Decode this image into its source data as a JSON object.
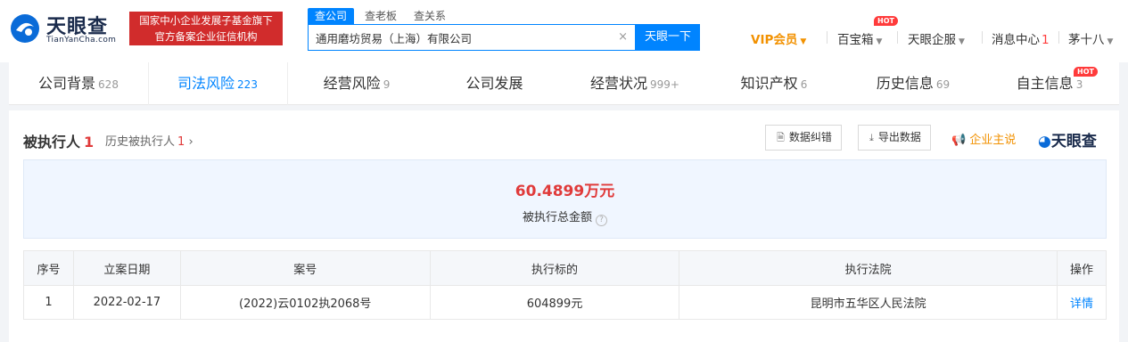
{
  "header": {
    "logo_name": "天眼查",
    "logo_domain": "TianYanCha.com",
    "banner_line1": "国家中小企业发展子基金旗下",
    "banner_line2": "官方备案企业征信机构",
    "search_tabs": [
      "查公司",
      "查老板",
      "查关系"
    ],
    "search_value": "通用磨坊贸易（上海）有限公司",
    "search_clear": "×",
    "search_button": "天眼一下",
    "nav": {
      "vip": "VIP会员",
      "treasure": "百宝箱",
      "hot": "HOT",
      "enterprise": "天眼企服",
      "messages": "消息中心",
      "messages_count": "1",
      "user": "茅十八"
    }
  },
  "tabs": [
    {
      "label": "公司背景",
      "count": "628"
    },
    {
      "label": "司法风险",
      "count": "223"
    },
    {
      "label": "经营风险",
      "count": "9"
    },
    {
      "label": "公司发展",
      "count": ""
    },
    {
      "label": "经营状况",
      "count": "999+"
    },
    {
      "label": "知识产权",
      "count": "6"
    },
    {
      "label": "历史信息",
      "count": "69"
    },
    {
      "label": "自主信息",
      "count": "3"
    }
  ],
  "tab_hot": "HOT",
  "section": {
    "title": "被执行人",
    "count": "1",
    "history_label": "历史被执行人",
    "history_count": "1",
    "history_arrow": "›",
    "btn_error": "数据纠错",
    "btn_export": "导出数据",
    "owner_say": "企业主说",
    "brand": "天眼查"
  },
  "summary": {
    "amount": "60.4899",
    "unit": "万元",
    "label": "被执行总金额"
  },
  "table": {
    "headers": [
      "序号",
      "立案日期",
      "案号",
      "执行标的",
      "执行法院",
      "操作"
    ],
    "rows": [
      [
        "1",
        "2022-02-17",
        "(2022)云0102执2068号",
        "604899元",
        "昆明市五华区人民法院",
        "详情"
      ]
    ]
  },
  "colors": {
    "accent": "#0084ff",
    "alert": "#e03a3a",
    "vip": "#f29100",
    "banner": "#d12c2c"
  }
}
